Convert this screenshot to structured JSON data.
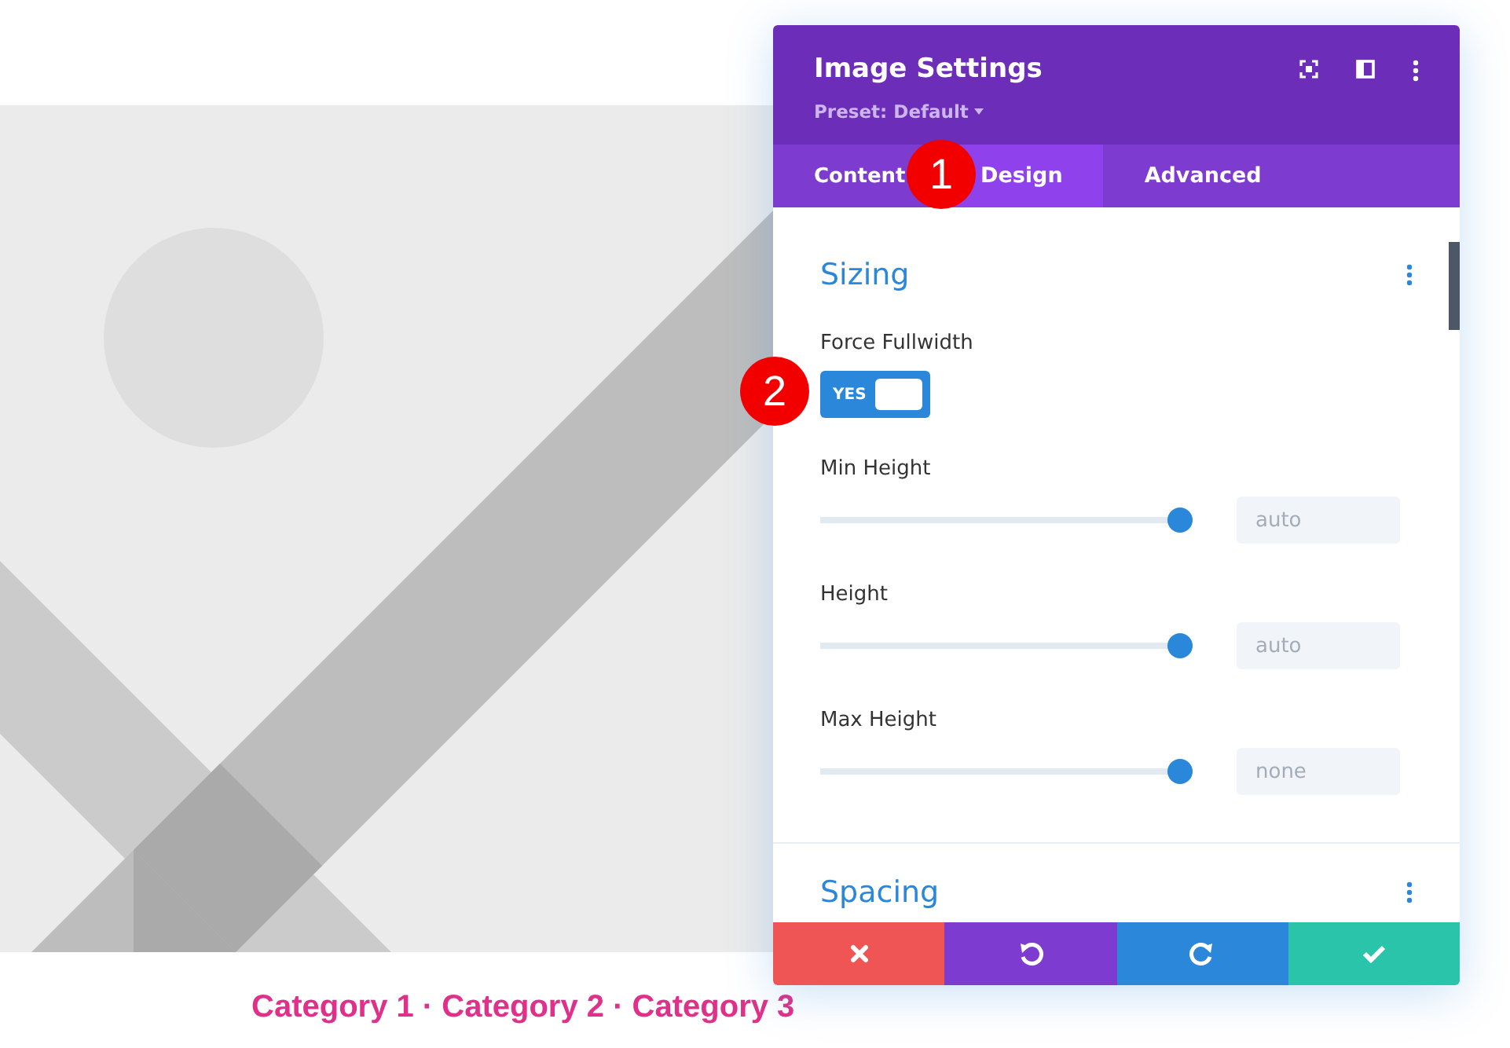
{
  "page": {
    "caption": "Category 1 · Category 2 · Category 3"
  },
  "panel": {
    "title": "Image Settings",
    "preset": "Preset: Default",
    "tabs": [
      {
        "label": "Content",
        "selected": false
      },
      {
        "label": "Design",
        "selected": true
      },
      {
        "label": "Advanced",
        "selected": false
      }
    ],
    "sections": [
      {
        "title": "Sizing",
        "fields": [
          {
            "kind": "toggle",
            "label": "Force Fullwidth",
            "value": "YES",
            "on": true
          },
          {
            "kind": "slider",
            "label": "Min Height",
            "level": 0.97,
            "placeholder": "auto"
          },
          {
            "kind": "slider",
            "label": "Height",
            "level": 0.97,
            "placeholder": "auto"
          },
          {
            "kind": "slider",
            "label": "Max Height",
            "level": 0.97,
            "placeholder": "none"
          }
        ]
      },
      {
        "title": "Spacing"
      }
    ],
    "footer_buttons": [
      {
        "kind": "cancel"
      },
      {
        "kind": "undo"
      },
      {
        "kind": "redo"
      },
      {
        "kind": "save"
      }
    ]
  },
  "markers": [
    {
      "label": "1"
    },
    {
      "label": "2"
    }
  ]
}
